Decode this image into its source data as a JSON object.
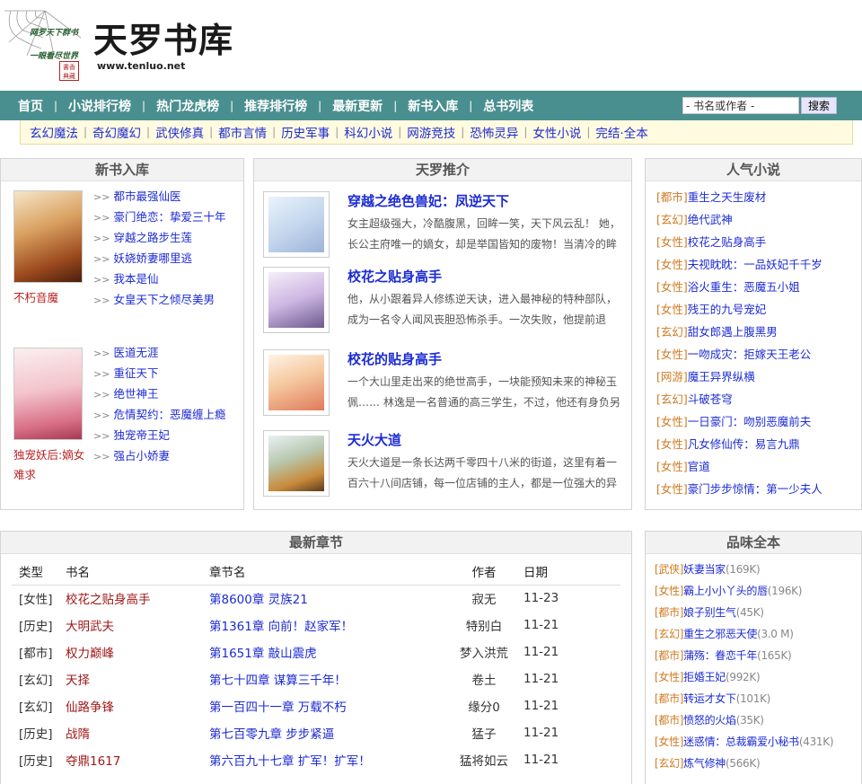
{
  "header": {
    "slogan_line1": "网罗天下群书",
    "slogan_line2": "一眼看尽世界",
    "seal_text": "書香典藏",
    "site_title": "天罗书库",
    "site_url": "www.tenluo.net"
  },
  "nav": {
    "items": [
      "首页",
      "小说排行榜",
      "热门龙虎榜",
      "推荐排行榜",
      "最新更新",
      "新书入库",
      "总书列表"
    ],
    "separator": "|",
    "search_placeholder": "- 书名或作者 -",
    "search_button": "搜索"
  },
  "subnav": {
    "items": [
      "玄幻魔法",
      "奇幻魔幻",
      "武侠修真",
      "都市言情",
      "历史军事",
      "科幻小说",
      "网游竞技",
      "恐怖灵异",
      "女性小说",
      "完结·全本"
    ],
    "separator": "|"
  },
  "new_books": {
    "title": "新书入库",
    "arrow": ">>",
    "group1": {
      "cover_name": "不朽音魔",
      "items": [
        "都市最强仙医",
        "豪门绝恋：挚爱三十年",
        "穿越之路步生莲",
        "妖娆娇妻哪里逃",
        "我本是仙",
        "女皇天下之倾尽美男"
      ]
    },
    "group2": {
      "cover_name_line1": "独宠妖后:嫡女",
      "cover_name_line2": "难求",
      "items": [
        "医道无涯",
        "重征天下",
        "绝世神王",
        "危情契约：恶魔缠上瘾",
        "独宠帝王妃",
        "强占小娇妻"
      ]
    }
  },
  "recommend": {
    "title": "天罗推介",
    "items": [
      {
        "title": "穿越之绝色兽妃：凤逆天下",
        "desc": "女主超级强大，冷酷腹黑，回眸一笑，天下风云乱！ 她，长公主府唯一的嫡女，却是举国皆知的废物！当清冷的眸"
      },
      {
        "title": "校花之贴身高手",
        "desc": "他，从小跟着异人修练逆天诀，进入最神秘的特种部队，成为一名令人闻风丧胆恐怖杀手。一次失败，他提前退"
      },
      {
        "title": "校花的贴身高手",
        "desc": "一个大山里走出来的绝世高手，一块能预知未来的神秘玉佩……  林逸是一名普通的高三学生，不过，他还有身负另"
      },
      {
        "title": "天火大道",
        "desc": "天火大道是一条长达两千零四十八米的街道，这里有着一百六十八间店铺，每一位店铺的主人，都是一位强大的异"
      }
    ]
  },
  "popular": {
    "title": "人气小说",
    "items": [
      {
        "tag": "[都市]",
        "name": "重生之天生废材"
      },
      {
        "tag": "[玄幻]",
        "name": "绝代武神"
      },
      {
        "tag": "[女性]",
        "name": "校花之贴身高手"
      },
      {
        "tag": "[女性]",
        "name": "夫视眈眈：一品妖妃千千岁"
      },
      {
        "tag": "[女性]",
        "name": "浴火重生：恶魔五小姐"
      },
      {
        "tag": "[女性]",
        "name": "残王的九号宠妃"
      },
      {
        "tag": "[玄幻]",
        "name": "甜女郎遇上腹黑男"
      },
      {
        "tag": "[女性]",
        "name": "一吻成灾：拒嫁天王老公"
      },
      {
        "tag": "[网游]",
        "name": "魔王异界纵横"
      },
      {
        "tag": "[玄幻]",
        "name": "斗破苍穹"
      },
      {
        "tag": "[女性]",
        "name": "一日豪门：吻别恶魔前夫"
      },
      {
        "tag": "[女性]",
        "name": "凡女修仙传：易言九鼎"
      },
      {
        "tag": "[女性]",
        "name": "官道"
      },
      {
        "tag": "[女性]",
        "name": "豪门步步惊情：第一少夫人"
      }
    ]
  },
  "latest": {
    "title": "最新章节",
    "headers": [
      "类型",
      "书名",
      "章节名",
      "作者",
      "日期"
    ],
    "rows": [
      {
        "type": "[女性]",
        "book": "校花之贴身高手",
        "chapter": "第8600章 灵族21",
        "author": "寂无",
        "date": "11-23"
      },
      {
        "type": "[历史]",
        "book": "大明武夫",
        "chapter": "第1361章 向前！赵家军！",
        "author": "特别白",
        "date": "11-21"
      },
      {
        "type": "[都市]",
        "book": "权力巅峰",
        "chapter": "第1651章 敲山震虎",
        "author": "梦入洪荒",
        "date": "11-21"
      },
      {
        "type": "[玄幻]",
        "book": "天择",
        "chapter": "第七十四章 谋算三千年！",
        "author": "卷土",
        "date": "11-21"
      },
      {
        "type": "[玄幻]",
        "book": "仙路争锋",
        "chapter": "第一百四十一章 万载不朽",
        "author": "缘分0",
        "date": "11-21"
      },
      {
        "type": "[历史]",
        "book": "战隋",
        "chapter": "第七百零九章 步步紧逼",
        "author": "猛子",
        "date": "11-21"
      },
      {
        "type": "[历史]",
        "book": "夺鼎1617",
        "chapter": "第六百九十七章 扩军！扩军！",
        "author": "猛将如云",
        "date": "11-21"
      }
    ]
  },
  "complete": {
    "title": "品味全本",
    "items": [
      {
        "tag": "[武侠]",
        "name": "妖妻当家",
        "size": "(169K)"
      },
      {
        "tag": "[女性]",
        "name": "霸上小小丫头的唇",
        "size": "(196K)"
      },
      {
        "tag": "[都市]",
        "name": "娘子别生气",
        "size": "(45K)"
      },
      {
        "tag": "[玄幻]",
        "name": "重生之邪恶天使",
        "size": "(3.0 M)"
      },
      {
        "tag": "[都市]",
        "name": "蒲殇：眷恋千年",
        "size": "(165K)"
      },
      {
        "tag": "[女性]",
        "name": "拒婚王妃",
        "size": "(992K)"
      },
      {
        "tag": "[都市]",
        "name": "转运才女下",
        "size": "(101K)"
      },
      {
        "tag": "[都市]",
        "name": "愤怒的火焰",
        "size": "(35K)"
      },
      {
        "tag": "[女性]",
        "name": "迷惑情：总裁霸爱小秘书",
        "size": "(431K)"
      },
      {
        "tag": "[玄幻]",
        "name": "炼气修神",
        "size": "(566K)"
      }
    ]
  },
  "colors": {
    "nav_bg": "#4a8f8f",
    "link_blue": "#1c2bd4",
    "book_red": "#a01818",
    "tag_orange": "#d07a22",
    "subnav_bg": "#fffbe0"
  }
}
